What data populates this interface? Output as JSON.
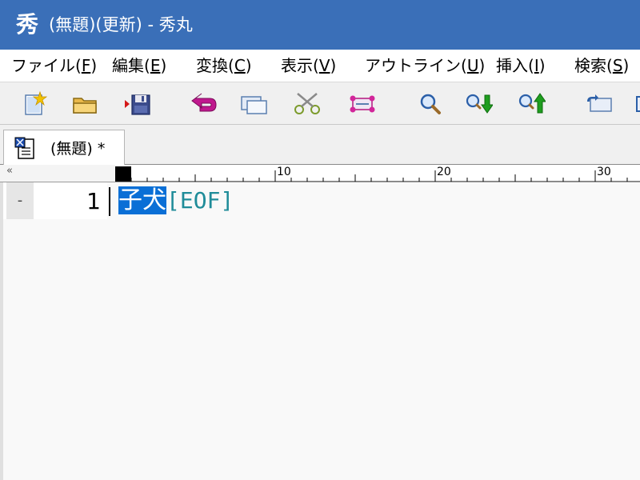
{
  "window": {
    "title": "(無題)(更新) - 秀丸",
    "app_icon": "秀"
  },
  "menu": {
    "items": [
      {
        "label": "ファイル(",
        "key": "F",
        "suffix": ")"
      },
      {
        "label": "編集(",
        "key": "E",
        "suffix": ")"
      },
      {
        "label": "変換(",
        "key": "C",
        "suffix": ")"
      },
      {
        "label": "表示(",
        "key": "V",
        "suffix": ")"
      },
      {
        "label": "アウトライン(",
        "key": "U",
        "suffix": ")"
      },
      {
        "label": "挿入(",
        "key": "I",
        "suffix": ")"
      },
      {
        "label": "検索(",
        "key": "S",
        "suffix": ")"
      }
    ]
  },
  "toolbar": {
    "icons": [
      "new-file-icon",
      "open-folder-icon",
      "save-icon",
      "undo-icon",
      "copy-icon",
      "cut-icon",
      "paste-icon",
      "search-icon",
      "search-down-icon",
      "search-up-icon",
      "replace-icon"
    ]
  },
  "tabs": [
    {
      "label": "(無題) *"
    }
  ],
  "ruler": {
    "toggle": "«",
    "labels": [
      "10",
      "20",
      "30"
    ]
  },
  "editor": {
    "fold_mark": "-",
    "line_number": "1",
    "selected_text": "子犬",
    "eof_marker": "[EOF]"
  },
  "colors": {
    "titlebar": "#3a6fb8",
    "selection": "#0a6fd6",
    "eof": "#1f8c99"
  }
}
